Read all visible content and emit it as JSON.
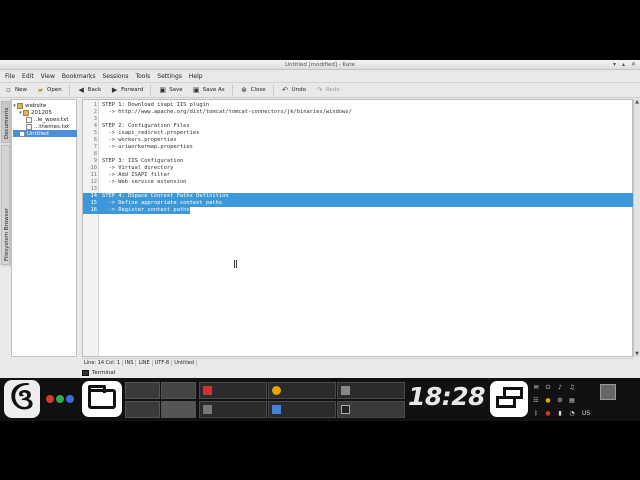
{
  "window": {
    "title": "Untitled [modified] - Kate"
  },
  "menu": [
    "File",
    "Edit",
    "View",
    "Bookmarks",
    "Sessions",
    "Tools",
    "Settings",
    "Help"
  ],
  "toolbar": {
    "new": "New",
    "open": "Open",
    "back": "Back",
    "forward": "Forward",
    "save": "Save",
    "save_as": "Save As",
    "close": "Close",
    "undo": "Undo",
    "redo": "Redo"
  },
  "side_tabs": {
    "documents": "Documents",
    "filesystem": "Filesystem Browser"
  },
  "file_tree": {
    "root": "website",
    "child": "201205",
    "files": [
      "..le_woes.txt",
      "...themes.txt"
    ],
    "selected": "Untitled"
  },
  "editor": {
    "lines": [
      "STEP 1: Download isapi IIS plugin",
      "  -> http://www.apache.org/dist/tomcat/tomcat-connectors/jk/binaries/windows/",
      "",
      "STEP 2: Configuration Files",
      "  -> isapi_redirect.properties",
      "  -> workers.properties",
      "  -> uriworkermap.properties",
      "",
      "STEP 3: IIS Configuration",
      "  -> Virtual directory",
      "  -> Add ISAPI filter",
      "  -> Web service extension",
      "",
      "STEP 4: DSpace Context Paths Definition",
      "  -> Define appropriate context paths",
      "  -> Register context paths"
    ],
    "highlighted_lines": [
      14,
      15,
      16
    ]
  },
  "status": {
    "position": "Line: 14 Col: 1",
    "mode": "INS",
    "wrap": "LINE",
    "encoding": "UTF-8",
    "doc": "Untitled"
  },
  "terminal_label": "Terminal",
  "taskbar": {
    "clock": "18:28",
    "keyboard_layout": "US",
    "colors": {
      "red": "#d23a2a",
      "green": "#3aa84a",
      "blue": "#3a6fd8"
    }
  }
}
